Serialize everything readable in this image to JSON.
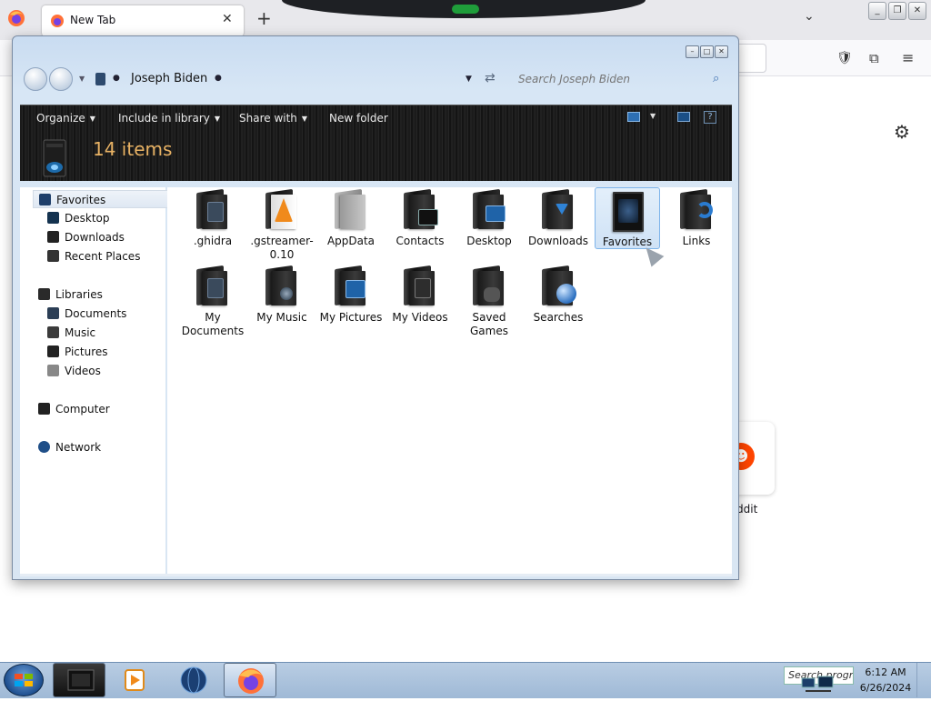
{
  "browser": {
    "tab_title": "New Tab",
    "new_tab_symbol": "+",
    "tab_close_symbol": "✕",
    "list_tabs_symbol": "⌄",
    "shortcut_tile_label": "ddit",
    "accent_orange": "#ff4500"
  },
  "explorer": {
    "address": {
      "breadcrumb_label": "Joseph Biden"
    },
    "search": {
      "placeholder": "Search Joseph Biden"
    },
    "toolbar": {
      "organize": "Organize",
      "include_in_library": "Include in library",
      "share_with": "Share with",
      "new_folder": "New folder"
    },
    "header": {
      "item_count": "14 items"
    },
    "nav": {
      "favorites": "Favorites",
      "desktop": "Desktop",
      "downloads": "Downloads",
      "recent_places": "Recent Places",
      "libraries": "Libraries",
      "documents": "Documents",
      "music": "Music",
      "pictures": "Pictures",
      "videos": "Videos",
      "computer": "Computer",
      "network": "Network"
    },
    "items": [
      {
        "label": ".ghidra"
      },
      {
        "label": ".gstreamer-0.10"
      },
      {
        "label": "AppData"
      },
      {
        "label": "Contacts"
      },
      {
        "label": "Desktop"
      },
      {
        "label": "Downloads"
      },
      {
        "label": "Favorites",
        "selected": true
      },
      {
        "label": "Links"
      },
      {
        "label": "My Documents"
      },
      {
        "label": "My Music"
      },
      {
        "label": "My Pictures"
      },
      {
        "label": "My Videos"
      },
      {
        "label": "Saved Games"
      },
      {
        "label": "Searches"
      }
    ],
    "header_text_color": "#e8b264",
    "selection_color": "#cfe2f6"
  },
  "taskbar": {
    "search_placeholder": "Search progra",
    "time": "6:12 AM",
    "date": "6/26/2024"
  }
}
